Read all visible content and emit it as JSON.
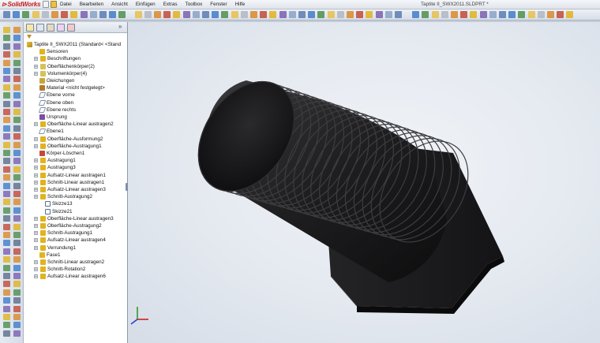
{
  "app": {
    "logo_text": "SolidWorks",
    "window_title": "Taptite II_SWX2011.SLDPRT *"
  },
  "menu": [
    "Datei",
    "Bearbeiten",
    "Ansicht",
    "Einfügen",
    "Extras",
    "Toolbox",
    "Fenster",
    "Hilfe"
  ],
  "feature_tree": {
    "root_label": "Taptite II_SWX2011  (Standard< <Stand",
    "items": [
      {
        "label": "Sensoren",
        "icon": "sensor-icon",
        "expandable": false
      },
      {
        "label": "Beschriftungen",
        "icon": "annotation-icon",
        "expandable": true
      },
      {
        "label": "Oberflächenkörper(2)",
        "icon": "surface-bodies-icon",
        "expandable": true
      },
      {
        "label": "Volumenkörper(4)",
        "icon": "solid-bodies-icon",
        "expandable": true
      },
      {
        "label": "Gleichungen",
        "icon": "equations-icon",
        "expandable": false
      },
      {
        "label": "Material <nicht festgelegt>",
        "icon": "material-icon",
        "expandable": false
      },
      {
        "label": "Ebene vorne",
        "icon": "plane-icon",
        "expandable": false
      },
      {
        "label": "Ebene oben",
        "icon": "plane-icon",
        "expandable": false
      },
      {
        "label": "Ebene rechts",
        "icon": "plane-icon",
        "expandable": false
      },
      {
        "label": "Ursprung",
        "icon": "origin-icon",
        "expandable": false
      },
      {
        "label": "Oberfläche-Linear austragen2",
        "icon": "surface-extrude-icon",
        "expandable": true
      },
      {
        "label": "Ebene1",
        "icon": "plane-icon",
        "expandable": false
      },
      {
        "label": "Oberfläche-Ausformung2",
        "icon": "surface-loft-icon",
        "expandable": true
      },
      {
        "label": "Oberfläche-Austragung1",
        "icon": "surface-sweep-icon",
        "expandable": true
      },
      {
        "label": "Körper-Löschen1",
        "icon": "delete-body-icon",
        "expandable": false
      },
      {
        "label": "Austragung1",
        "icon": "sweep-icon",
        "expandable": true
      },
      {
        "label": "Austragung3",
        "icon": "sweep-icon",
        "expandable": true
      },
      {
        "label": "Aufsatz-Linear austragen1",
        "icon": "boss-extrude-icon",
        "expandable": true
      },
      {
        "label": "Schnitt-Linear austragen1",
        "icon": "cut-extrude-icon",
        "expandable": true
      },
      {
        "label": "Aufsatz-Linear austragen3",
        "icon": "boss-extrude-icon",
        "expandable": true
      },
      {
        "label": "Schnitt-Austragung2",
        "icon": "cut-sweep-icon",
        "expandable": true
      },
      {
        "label": "Skizze13",
        "icon": "sketch-icon",
        "expandable": false,
        "child": true
      },
      {
        "label": "Skizze21",
        "icon": "sketch-icon",
        "expandable": false,
        "child": true
      },
      {
        "label": "Oberfläche-Linear austragen3",
        "icon": "surface-extrude-icon",
        "expandable": true
      },
      {
        "label": "Oberfläche-Austragung2",
        "icon": "surface-sweep-icon",
        "expandable": true
      },
      {
        "label": "Schnitt-Austragung1",
        "icon": "cut-sweep-icon",
        "expandable": true
      },
      {
        "label": "Aufsatz-Linear austragen4",
        "icon": "boss-extrude-icon",
        "expandable": true
      },
      {
        "label": "Verrundung1",
        "icon": "fillet-icon",
        "expandable": true
      },
      {
        "label": "Fase1",
        "icon": "chamfer-icon",
        "expandable": false
      },
      {
        "label": "Schnitt-Linear austragen2",
        "icon": "cut-extrude-icon",
        "expandable": true
      },
      {
        "label": "Schnitt-Rotation2",
        "icon": "cut-revolve-icon",
        "expandable": true
      },
      {
        "label": "Aufsatz-Linear austragen6",
        "icon": "boss-extrude-icon",
        "expandable": true
      }
    ]
  },
  "colors": {
    "viewport_bg": "#e4e9f0",
    "model": "#1c1c1e",
    "accent_red": "#c81e1e",
    "tree_icon_yellow": "#e0b320",
    "tree_icon_blue": "#2f6fd6"
  },
  "model": {
    "name": "Taptite II screw",
    "icon": "screw-model"
  }
}
